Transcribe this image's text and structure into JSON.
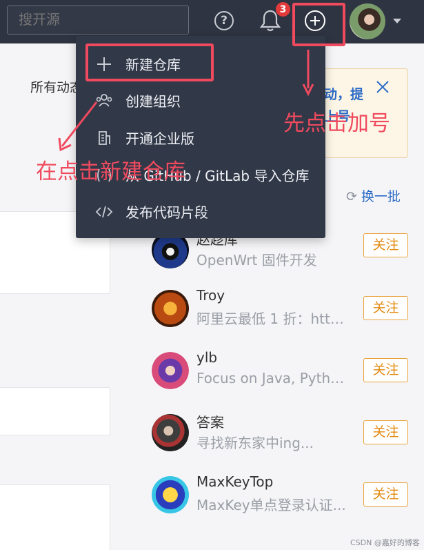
{
  "search": {
    "placeholder": "搜开源"
  },
  "header": {
    "help_icon": "?",
    "notification_count": "3",
    "colors": {
      "bar": "#2f3442",
      "highlight": "#f04a5e",
      "link": "#2c6bc7",
      "follow": "#e38a12"
    }
  },
  "filter": {
    "label": "所有动态"
  },
  "notice": {
    "line1": "动，提",
    "line2": "上号"
  },
  "menu": {
    "items": [
      {
        "label": "新建仓库",
        "icon": "plus-icon"
      },
      {
        "label": "创建组织",
        "icon": "group-icon"
      },
      {
        "label": "开通企业版",
        "icon": "building-icon"
      },
      {
        "label": "从 GitHub / GitLab 导入仓库",
        "icon": "import-icon"
      },
      {
        "label": "发布代码片段",
        "icon": "code-icon"
      }
    ]
  },
  "annotations": {
    "first": "先点击加号",
    "second": "在点击新建仓库"
  },
  "recommend": {
    "refresh_label": "换一批"
  },
  "users": [
    {
      "name": "赵趁库",
      "desc": "OpenWrt 固件开发",
      "follow": "关注"
    },
    {
      "name": "Troy",
      "desc": "阿里云最低 1 折：http...",
      "follow": "关注"
    },
    {
      "name": "ylb",
      "desc": "Focus on Java, Python ...",
      "follow": "关注"
    },
    {
      "name": "答案",
      "desc": "寻找新东家中ing...",
      "follow": "关注"
    },
    {
      "name": "MaxKeyTop",
      "desc": "MaxKey单点登录认证...",
      "follow": "关注"
    }
  ],
  "watermark": "CSDN @嘉好的博客"
}
